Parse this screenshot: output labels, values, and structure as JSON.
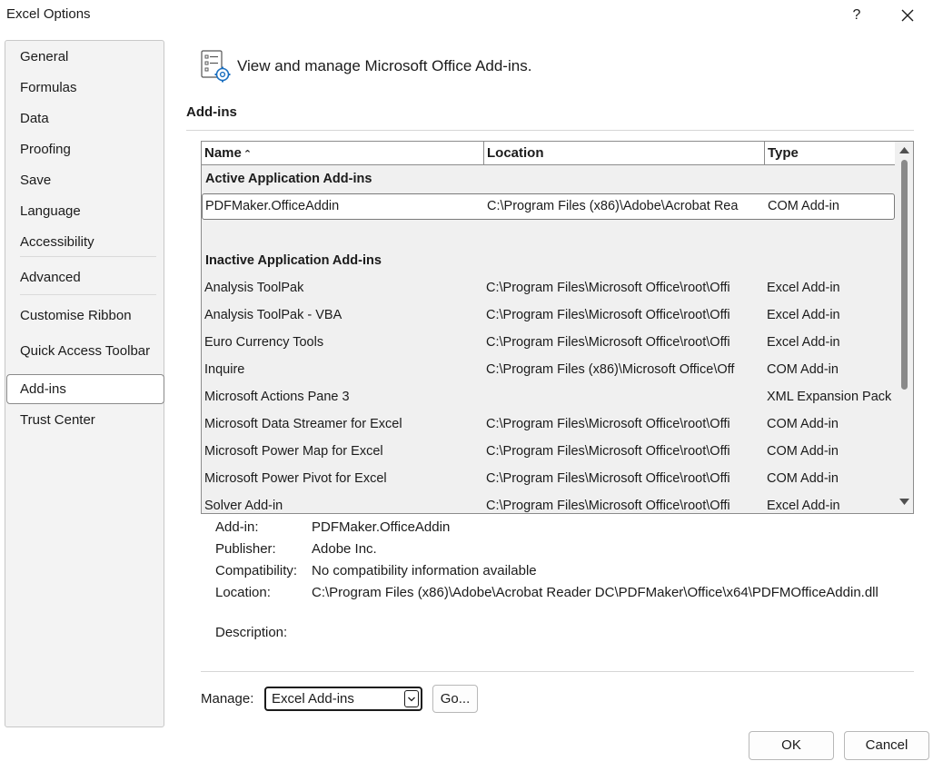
{
  "window": {
    "title": "Excel Options",
    "help_glyph": "?",
    "close_icon": "close-icon"
  },
  "sidebar": {
    "items": [
      {
        "label": "General"
      },
      {
        "label": "Formulas"
      },
      {
        "label": "Data"
      },
      {
        "label": "Proofing"
      },
      {
        "label": "Save"
      },
      {
        "label": "Language"
      },
      {
        "label": "Accessibility"
      },
      {
        "label": "Advanced"
      },
      {
        "label": "Customise Ribbon"
      },
      {
        "label": "Quick Access Toolbar"
      },
      {
        "label": "Add-ins",
        "selected": true
      },
      {
        "label": "Trust Center"
      }
    ]
  },
  "header": {
    "text": "View and manage Microsoft Office Add-ins."
  },
  "section": {
    "title": "Add-ins"
  },
  "table": {
    "columns": {
      "name": "Name",
      "sort_glyph": "⌃",
      "location": "Location",
      "type": "Type"
    },
    "groups": {
      "active": "Active Application Add-ins",
      "inactive": "Inactive Application Add-ins"
    },
    "active_rows": [
      {
        "name": "PDFMaker.OfficeAddin",
        "location": "C:\\Program Files (x86)\\Adobe\\Acrobat Rea",
        "type": "COM Add-in"
      }
    ],
    "inactive_rows": [
      {
        "name": "Analysis ToolPak",
        "location": "C:\\Program Files\\Microsoft Office\\root\\Offi",
        "type": "Excel Add-in"
      },
      {
        "name": "Analysis ToolPak - VBA",
        "location": "C:\\Program Files\\Microsoft Office\\root\\Offi",
        "type": "Excel Add-in"
      },
      {
        "name": "Euro Currency Tools",
        "location": "C:\\Program Files\\Microsoft Office\\root\\Offi",
        "type": "Excel Add-in"
      },
      {
        "name": "Inquire",
        "location": "C:\\Program Files (x86)\\Microsoft Office\\Off",
        "type": "COM Add-in"
      },
      {
        "name": "Microsoft Actions Pane 3",
        "location": "",
        "type": "XML Expansion Pack"
      },
      {
        "name": "Microsoft Data Streamer for Excel",
        "location": "C:\\Program Files\\Microsoft Office\\root\\Offi",
        "type": "COM Add-in"
      },
      {
        "name": "Microsoft Power Map for Excel",
        "location": "C:\\Program Files\\Microsoft Office\\root\\Offi",
        "type": "COM Add-in"
      },
      {
        "name": "Microsoft Power Pivot for Excel",
        "location": "C:\\Program Files\\Microsoft Office\\root\\Offi",
        "type": "COM Add-in"
      },
      {
        "name": "Solver Add-in",
        "location": "C:\\Program Files\\Microsoft Office\\root\\Offi",
        "type": "Excel Add-in"
      }
    ]
  },
  "details": {
    "addin_label": "Add-in:",
    "addin_value": "PDFMaker.OfficeAddin",
    "publisher_label": "Publisher:",
    "publisher_value": "Adobe Inc.",
    "compat_label": "Compatibility:",
    "compat_value": "No compatibility information available",
    "location_label": "Location:",
    "location_value": "C:\\Program Files (x86)\\Adobe\\Acrobat Reader DC\\PDFMaker\\Office\\x64\\PDFMOfficeAddin.dll",
    "description_label": "Description:"
  },
  "manage": {
    "label": "Manage:",
    "selected": "Excel Add-ins",
    "go_label": "Go..."
  },
  "footer": {
    "ok_label": "OK",
    "cancel_label": "Cancel"
  }
}
